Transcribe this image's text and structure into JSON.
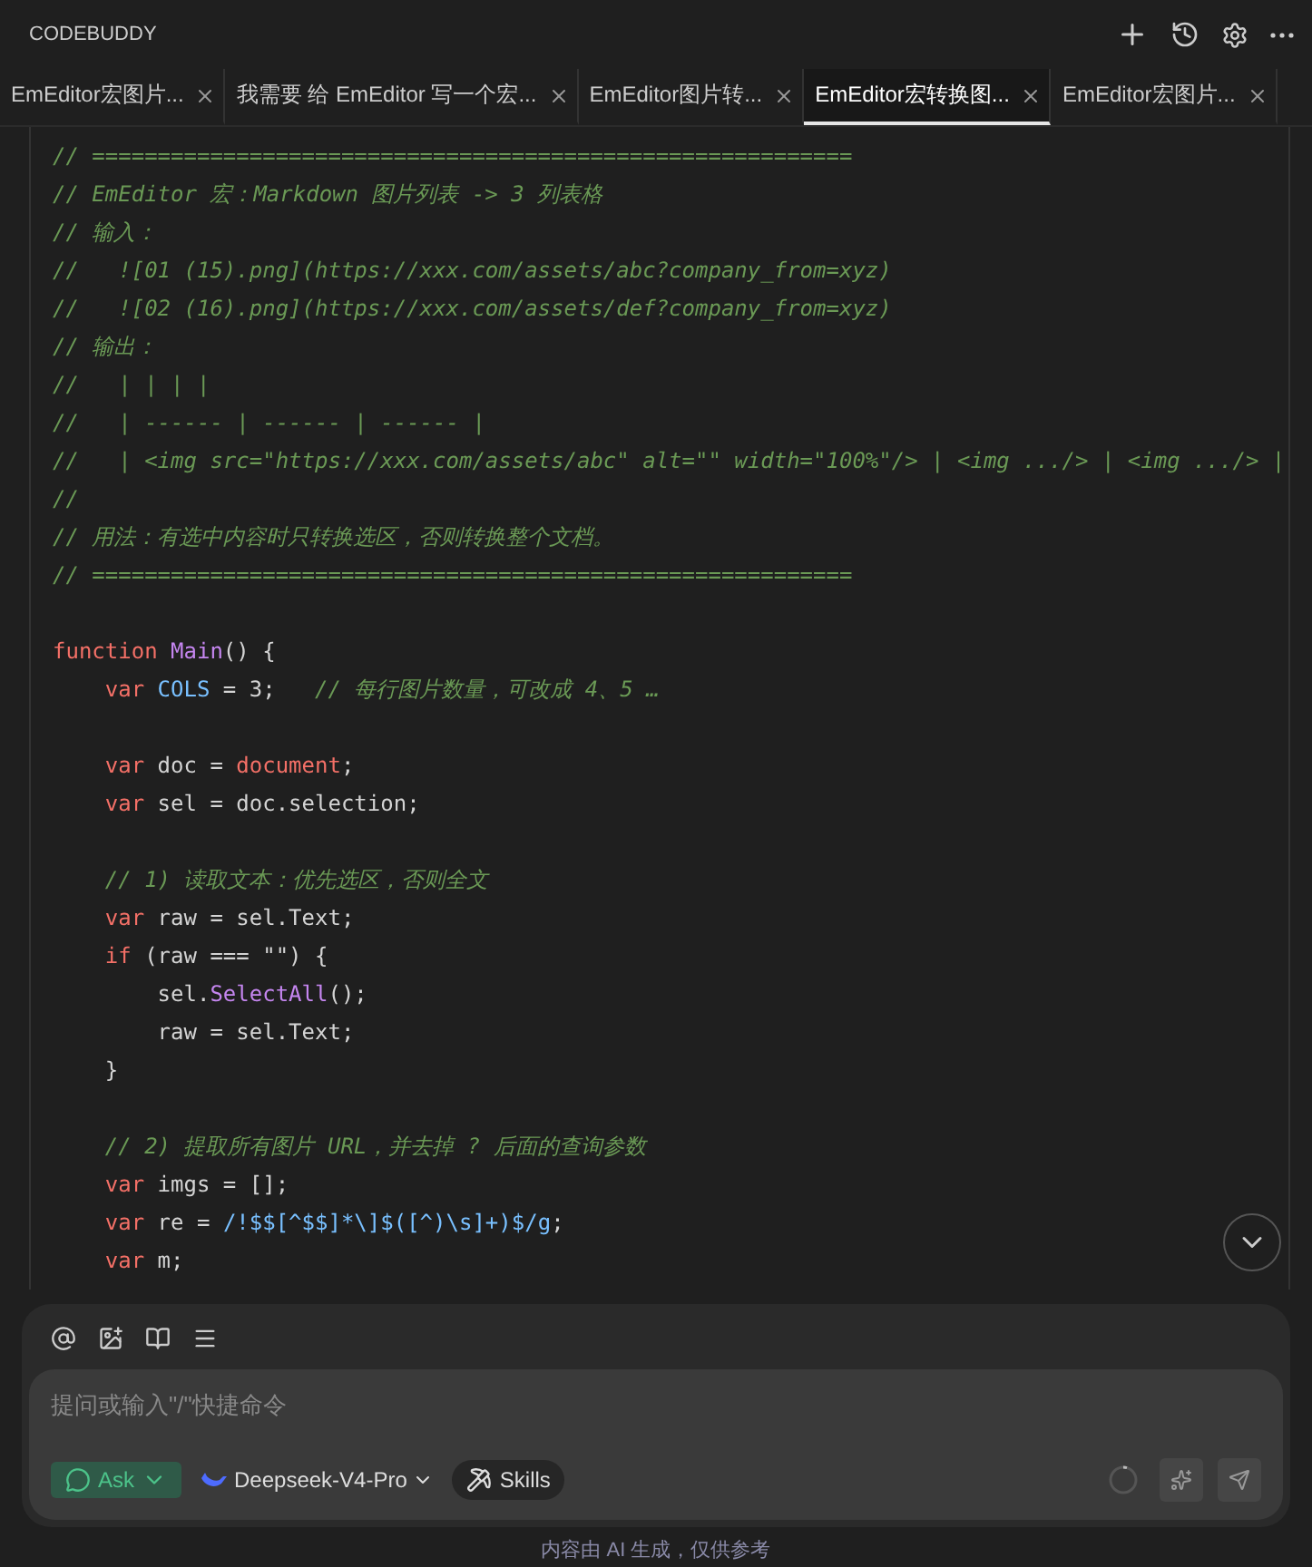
{
  "header": {
    "title": "CODEBUDDY"
  },
  "tabs": [
    {
      "label": "EmEditor宏图片...",
      "selected": false
    },
    {
      "label": "我需要 给 EmEditor 写一个宏...",
      "selected": false
    },
    {
      "label": "EmEditor图片转...",
      "selected": false
    },
    {
      "label": "EmEditor宏转换图...",
      "selected": true
    },
    {
      "label": "EmEditor宏图片...",
      "selected": false
    }
  ],
  "code_blocks": [
    {
      "lines": [
        {
          "tokens": [
            {
              "kind": "comment",
              "text": "// =========================================================="
            }
          ]
        },
        {
          "tokens": [
            {
              "kind": "comment",
              "text": "// EmEditor 宏：Markdown 图片列表 -> 3 列表格"
            }
          ]
        },
        {
          "tokens": [
            {
              "kind": "comment",
              "text": "// 输入："
            }
          ]
        },
        {
          "tokens": [
            {
              "kind": "comment",
              "text": "//   ![01 (15).png](https://xxx.com/assets/abc?company_from=xyz)"
            }
          ]
        },
        {
          "tokens": [
            {
              "kind": "comment",
              "text": "//   ![02 (16).png](https://xxx.com/assets/def?company_from=xyz)"
            }
          ]
        },
        {
          "tokens": [
            {
              "kind": "comment",
              "text": "// 输出："
            }
          ]
        },
        {
          "tokens": [
            {
              "kind": "comment",
              "text": "//   | | | |"
            }
          ]
        },
        {
          "tokens": [
            {
              "kind": "comment",
              "text": "//   | ------ | ------ | ------ |"
            }
          ]
        },
        {
          "tokens": [
            {
              "kind": "comment",
              "text": "//   | <img src=\"https://xxx.com/assets/abc\" alt=\"\" width=\"100%\"/> | <img .../> | <img .../> |"
            }
          ]
        },
        {
          "tokens": [
            {
              "kind": "comment",
              "text": "//"
            }
          ]
        },
        {
          "tokens": [
            {
              "kind": "comment",
              "text": "// 用法：有选中内容时只转换选区，否则转换整个文档。"
            }
          ]
        },
        {
          "tokens": [
            {
              "kind": "comment",
              "text": "// =========================================================="
            }
          ]
        }
      ]
    },
    {
      "lines": [
        {
          "tokens": [
            {
              "kind": "keyword",
              "text": "function"
            },
            {
              "kind": "function",
              "text": " Main"
            },
            {
              "kind": "plain",
              "text": "() {"
            }
          ]
        },
        {
          "tokens": [
            {
              "kind": "keyword",
              "text": "    var"
            },
            {
              "kind": "constant",
              "text": " COLS"
            },
            {
              "kind": "plain",
              "text": " = 3;   "
            },
            {
              "kind": "comment",
              "text": "// 每行图片数量，可改成 4、5 …"
            }
          ]
        }
      ]
    },
    {
      "lines": [
        {
          "tokens": [
            {
              "kind": "keyword",
              "text": "    var"
            },
            {
              "kind": "plain",
              "text": " doc = "
            },
            {
              "kind": "builtin",
              "text": "document"
            },
            {
              "kind": "plain",
              "text": ";"
            }
          ]
        },
        {
          "tokens": [
            {
              "kind": "keyword",
              "text": "    var"
            },
            {
              "kind": "plain",
              "text": " sel = doc.selection;"
            }
          ]
        }
      ]
    },
    {
      "lines": [
        {
          "tokens": [
            {
              "kind": "comment",
              "text": "    // 1) 读取文本：优先选区，否则全文"
            }
          ]
        },
        {
          "tokens": [
            {
              "kind": "keyword",
              "text": "    var"
            },
            {
              "kind": "plain",
              "text": " raw = sel.Text;"
            }
          ]
        },
        {
          "tokens": [
            {
              "kind": "keyword",
              "text": "    if"
            },
            {
              "kind": "plain",
              "text": " (raw === \"\") {"
            }
          ]
        },
        {
          "tokens": [
            {
              "kind": "plain",
              "text": "        sel."
            },
            {
              "kind": "function",
              "text": "SelectAll"
            },
            {
              "kind": "plain",
              "text": "();"
            }
          ]
        },
        {
          "tokens": [
            {
              "kind": "plain",
              "text": "        raw = sel.Text;"
            }
          ]
        },
        {
          "tokens": [
            {
              "kind": "plain",
              "text": "    }"
            }
          ]
        }
      ]
    },
    {
      "lines": [
        {
          "tokens": [
            {
              "kind": "comment",
              "text": "    // 2) 提取所有图片 URL，并去掉 ? 后面的查询参数"
            }
          ]
        },
        {
          "tokens": [
            {
              "kind": "keyword",
              "text": "    var"
            },
            {
              "kind": "plain",
              "text": " imgs = [];"
            }
          ]
        },
        {
          "tokens": [
            {
              "kind": "keyword",
              "text": "    var"
            },
            {
              "kind": "plain",
              "text": " re = "
            },
            {
              "kind": "regex",
              "text": "/!$$[^$$]*\\]$([^)\\s]+)$/g"
            },
            {
              "kind": "plain",
              "text": ";"
            }
          ]
        },
        {
          "tokens": [
            {
              "kind": "keyword",
              "text": "    var"
            },
            {
              "kind": "plain",
              "text": " m;"
            }
          ]
        }
      ]
    }
  ],
  "composer": {
    "placeholder": "提问或输入\"/\"快捷命令",
    "mode": "Ask",
    "model": "Deepseek-V4-Pro",
    "skills": "Skills"
  },
  "footer": "内容由 AI 生成，仅供参考"
}
